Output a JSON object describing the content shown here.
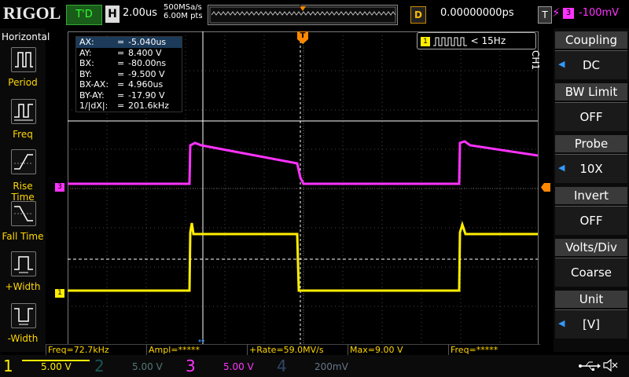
{
  "brand": "RIGOL",
  "trigger_state": "T'D",
  "horizontal": {
    "badge": "H",
    "timebase": "2.00us",
    "sample_rate": "500MSa/s",
    "mem_depth": "6.00M pts"
  },
  "delay": {
    "badge": "D",
    "value": "0.00000000ps"
  },
  "trigger": {
    "badge": "T",
    "source": "3",
    "level": "-100mV",
    "position_marker": "T"
  },
  "left_menu": {
    "title": "Horizontal",
    "items": [
      {
        "label": "Period",
        "icon": "period-icon"
      },
      {
        "label": "Freq",
        "icon": "freq-icon"
      },
      {
        "label": "Rise Time",
        "icon": "rise-time-icon"
      },
      {
        "label": "Fall Time",
        "icon": "fall-time-icon"
      },
      {
        "label": "+Width",
        "icon": "positive-width-icon"
      },
      {
        "label": "-Width",
        "icon": "negative-width-icon"
      }
    ]
  },
  "right_menu": {
    "channel_tag": "CH1",
    "items": [
      {
        "title": "Coupling",
        "value": "DC",
        "arrow": true
      },
      {
        "title": "BW Limit",
        "value": "OFF",
        "arrow": false
      },
      {
        "title": "Probe",
        "value": "10X",
        "arrow": true
      },
      {
        "title": "Invert",
        "value": "OFF",
        "arrow": false
      },
      {
        "title": "Volts/Div",
        "value": "Coarse",
        "arrow": false
      },
      {
        "title": "Unit",
        "value": "[V]",
        "arrow": true
      }
    ]
  },
  "cursors": [
    {
      "key": "AX:",
      "eq": "=",
      "val": "-5.040us"
    },
    {
      "key": "AY:",
      "eq": "=",
      "val": "8.400 V"
    },
    {
      "key": "BX:",
      "eq": "=",
      "val": "-80.00ns"
    },
    {
      "key": "BY:",
      "eq": "=",
      "val": "-9.500 V"
    },
    {
      "key": "BX-AX:",
      "eq": "=",
      "val": "4.960us"
    },
    {
      "key": "BY-AY:",
      "eq": "=",
      "val": "-17.90 V"
    },
    {
      "key": "1/|dX|:",
      "eq": "=",
      "val": "201.6kHz"
    }
  ],
  "freq_counter": {
    "channel": "1",
    "value": "< 15Hz"
  },
  "markers": {
    "ch1": "1",
    "ch3": "3",
    "cursor_bottom": "↔"
  },
  "measurements": [
    {
      "text": "Freq=72.7kHz"
    },
    {
      "text": "Ampl=*****"
    },
    {
      "text": "+Rate=59.0MV/s"
    },
    {
      "text": "Max=9.00 V"
    },
    {
      "text": "Freq=*****"
    }
  ],
  "channels": [
    {
      "num": "1",
      "scale": "5.00 V",
      "color": "#ffee00",
      "active": true
    },
    {
      "num": "2",
      "scale": "5.00 V",
      "color": "#00c8c8",
      "active": false
    },
    {
      "num": "3",
      "scale": "5.00 V",
      "color": "#ff33ff",
      "active": true
    },
    {
      "num": "4",
      "scale": "200mV",
      "color": "#3366ff",
      "active": false
    }
  ],
  "colors": {
    "ch1": "#ffee00",
    "ch3": "#ff33ff",
    "trigger": "#ff8800",
    "accent": "#3399ff"
  }
}
